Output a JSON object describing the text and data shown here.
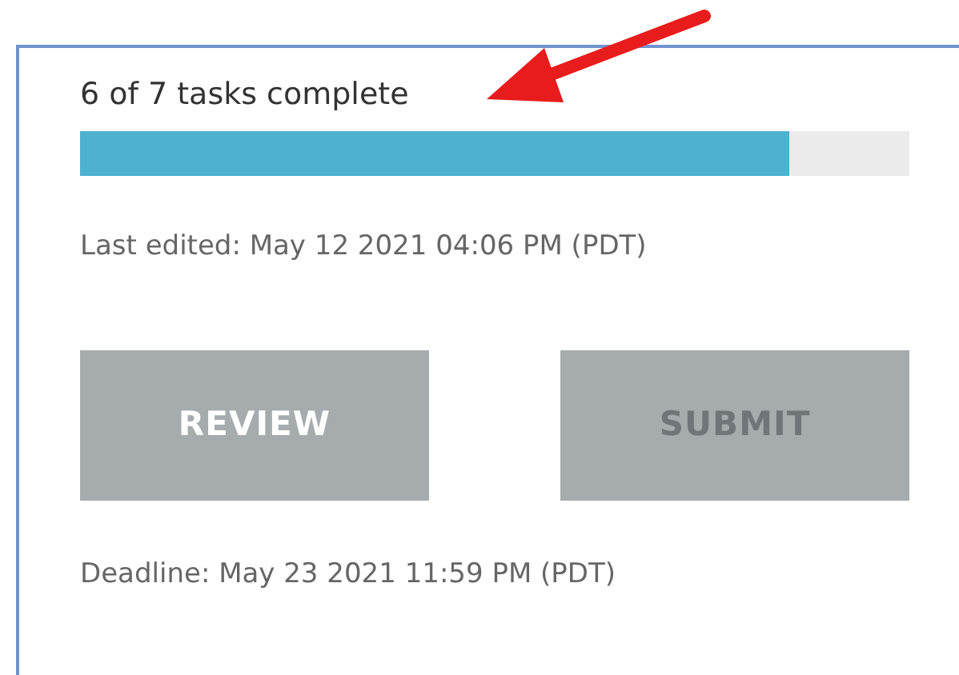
{
  "progress": {
    "label": "6 of 7 tasks complete",
    "level": 0.855
  },
  "last_edited": "Last edited: May 12 2021 04:06 PM (PDT)",
  "buttons": [
    {
      "label": "REVIEW",
      "disabled": false
    },
    {
      "label": "SUBMIT",
      "disabled": true
    }
  ],
  "deadline": "Deadline: May 23 2021 11:59 PM (PDT)"
}
